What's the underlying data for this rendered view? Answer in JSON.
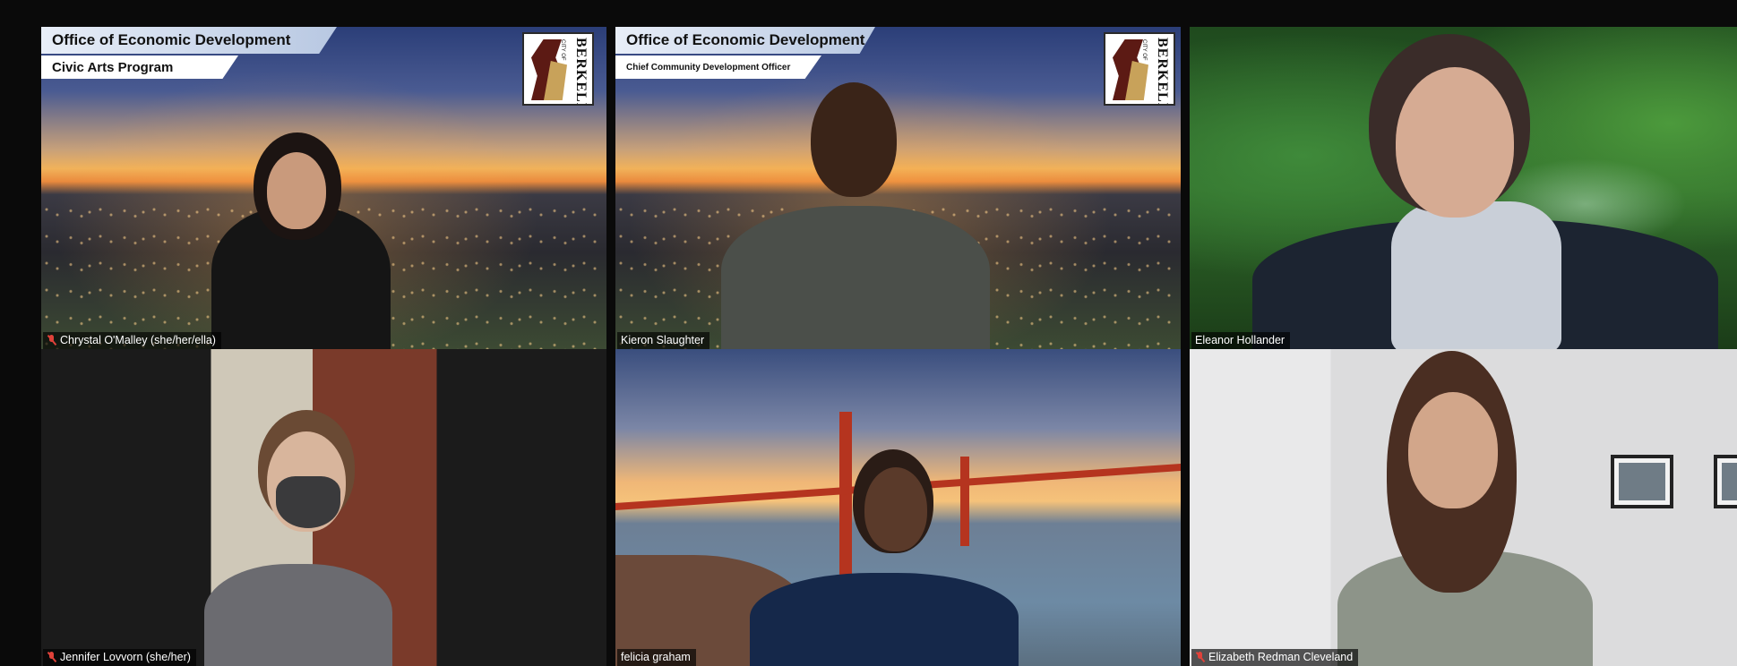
{
  "participants": [
    {
      "name": "Chrystal O'Malley (she/her/ella)",
      "muted": true,
      "background": "sunset-city",
      "banner_title": "Office of Economic Development",
      "banner_subtitle": "Civic Arts Program",
      "logo_text": "BERKELEY",
      "logo_small": "CITY OF"
    },
    {
      "name": "Kieron Slaughter",
      "muted": false,
      "background": "sunset-city",
      "banner_title": "Office of Economic Development",
      "banner_subtitle": "Chief Community Development Officer",
      "logo_text": "BERKELEY",
      "logo_small": "CITY OF"
    },
    {
      "name": "Eleanor  Hollander",
      "muted": false,
      "active_speaker": true,
      "background": "jungle"
    },
    {
      "name": "Jennifer Lovvorn (she/her)",
      "muted": true,
      "background": "room"
    },
    {
      "name": "felicia graham",
      "muted": false,
      "background": "golden-gate-bridge"
    },
    {
      "name": "Elizabeth Redman Cleveland",
      "muted": true,
      "background": "room"
    }
  ],
  "colors": {
    "active_speaker_border": "#c6e76a",
    "muted_icon": "#e0423a",
    "name_tag_bg": "rgba(0,0,0,0.65)"
  },
  "icons": {
    "muted": "mic-muted-icon"
  }
}
